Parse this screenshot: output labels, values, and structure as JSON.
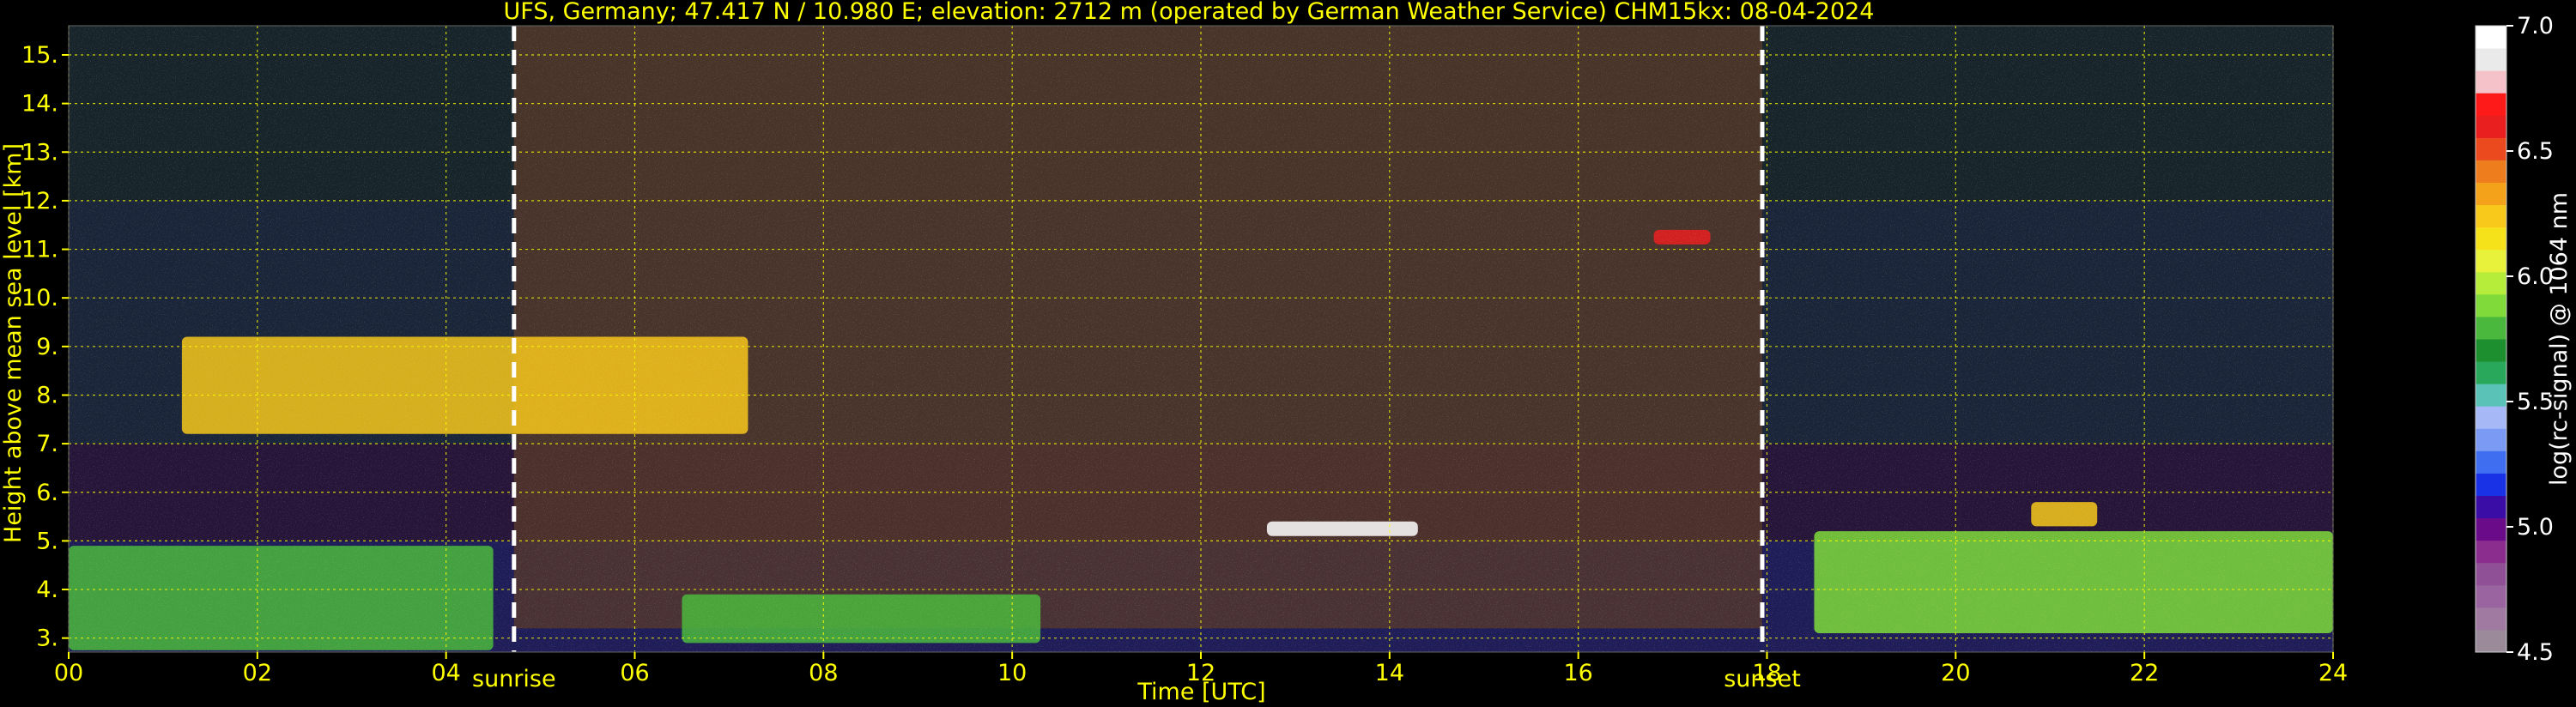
{
  "colors": {
    "background": "#000000",
    "text": "#ffff00",
    "grid": "#ffff00",
    "cbar_text": "#ffffff"
  },
  "chart_data": {
    "type": "heatmap",
    "title": "UFS, Germany; 47.417 N / 10.980 E; elevation: 2712 m  (operated by German Weather Service)    CHM15kx: 08-04-2024",
    "xlabel": "Time [UTC]",
    "ylabel": "Height above mean sea level [km]",
    "xlim": [
      0,
      24
    ],
    "ylim": [
      2.712,
      15.6
    ],
    "xticks": [
      "00",
      "02",
      "04",
      "06",
      "08",
      "10",
      "12",
      "14",
      "16",
      "18",
      "20",
      "22",
      "24"
    ],
    "yticks": [
      "3.",
      "4.",
      "5.",
      "6.",
      "7.",
      "8.",
      "9.",
      "10.",
      "11.",
      "12.",
      "13.",
      "14.",
      "15."
    ],
    "grid": true,
    "events": [
      {
        "label": "sunrise",
        "time": 4.72
      },
      {
        "label": "sunset",
        "time": 17.95
      }
    ],
    "colorbar": {
      "label": "log(rc-signal) @ 1064 nm",
      "range": [
        4.5,
        7.0
      ],
      "ticks": [
        "4.5",
        "5.0",
        "5.5",
        "6.0",
        "6.5",
        "7.0"
      ],
      "colors": [
        "#9a8a9a",
        "#a07aa0",
        "#9a64a0",
        "#905096",
        "#8a2d8f",
        "#6a0c8a",
        "#3a0ea6",
        "#1a32e6",
        "#3f6ff0",
        "#7a9af3",
        "#a6b8f6",
        "#5bc2b8",
        "#29a85c",
        "#1e8f2e",
        "#4ab83c",
        "#7fda3a",
        "#b6ec3a",
        "#e8f23a",
        "#f6e21a",
        "#f8c81a",
        "#f3a21a",
        "#ee7d1e",
        "#ea4a1e",
        "#e91e1e",
        "#ff1a1a",
        "#f4c2c8",
        "#eaeaea",
        "#ffffff"
      ]
    },
    "features": [
      {
        "name": "boundary-layer-aerosol-morning",
        "t0": 0.0,
        "t1": 4.5,
        "h0": 2.75,
        "h1": 4.9,
        "level": 5.8
      },
      {
        "name": "boundary-layer-aerosol-day",
        "t0": 6.5,
        "t1": 10.3,
        "h0": 2.9,
        "h1": 3.9,
        "level": 5.75
      },
      {
        "name": "boundary-layer-aerosol-evening",
        "t0": 18.5,
        "t1": 24.0,
        "h0": 3.1,
        "h1": 5.2,
        "level": 5.85
      },
      {
        "name": "cirrus-cloud-morning",
        "t0": 1.2,
        "t1": 7.2,
        "h0": 7.2,
        "h1": 9.2,
        "level": 6.3
      },
      {
        "name": "mid-level-cloud",
        "t0": 12.7,
        "t1": 14.3,
        "h0": 5.1,
        "h1": 5.4,
        "level": 7.0
      },
      {
        "name": "cirrus-cloud-afternoon",
        "t0": 16.8,
        "t1": 17.4,
        "h0": 11.1,
        "h1": 11.4,
        "level": 6.6
      },
      {
        "name": "aerosol-layer-evening",
        "t0": 20.8,
        "t1": 21.5,
        "h0": 5.3,
        "h1": 5.8,
        "level": 6.3
      }
    ]
  }
}
